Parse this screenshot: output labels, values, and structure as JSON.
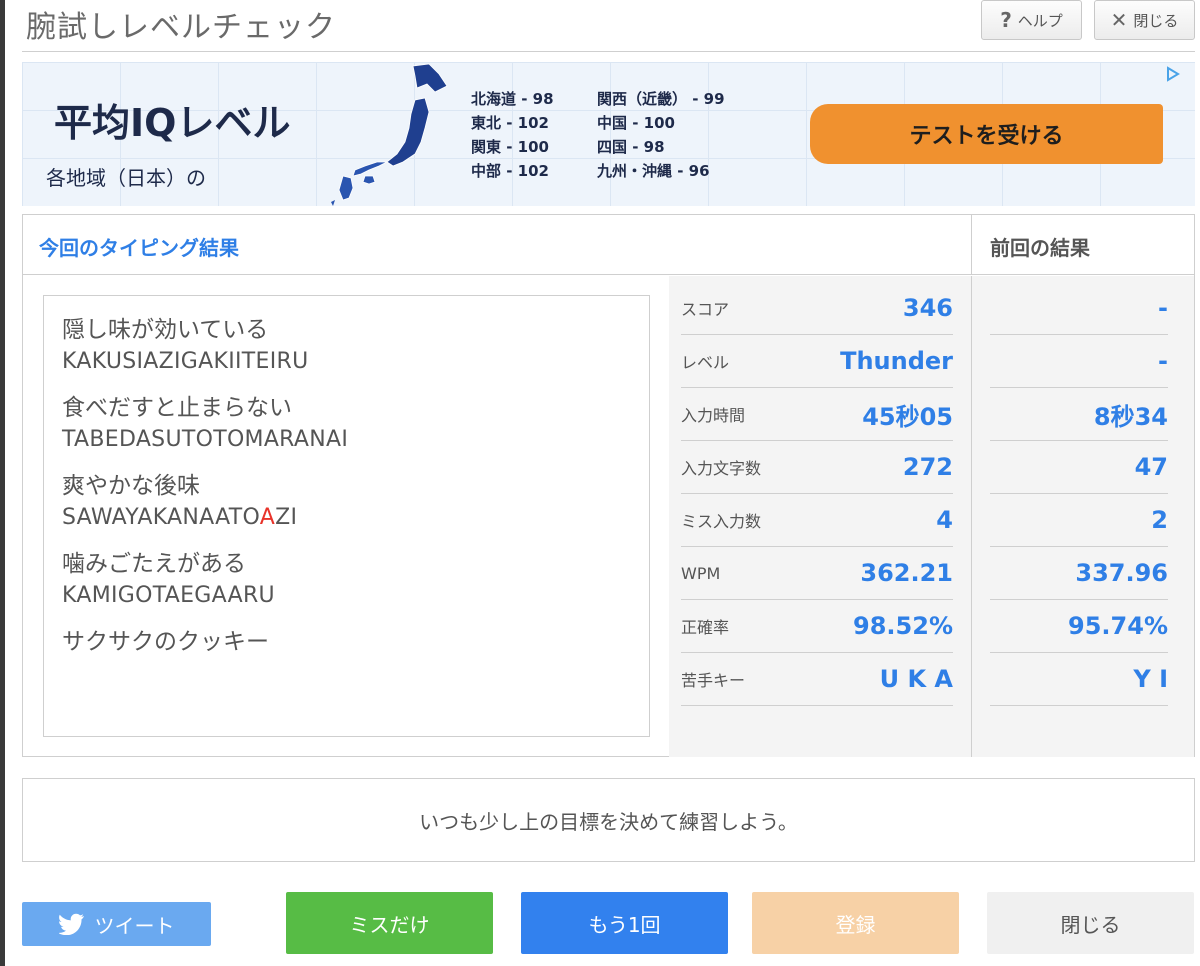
{
  "window": {
    "title": "腕試しレベルチェック",
    "help_label": "ヘルプ",
    "help_icon": "question-icon",
    "close_label": "閉じる",
    "close_icon": "close-icon"
  },
  "ad": {
    "headline": "平均IQレベル",
    "subline": "各地域（日本）の",
    "regions_col1": [
      "北海道 - 98",
      "東北 - 102",
      "関東 - 100",
      "中部 - 102"
    ],
    "regions_col2": [
      "関西（近畿） - 99",
      "中国 - 100",
      "四国 - 98",
      "九州・沖縄 - 96"
    ],
    "cta": "テストを受ける",
    "map_icon": "japan-map-icon",
    "adchoices_icon": "adchoices-icon"
  },
  "results": {
    "current_title": "今回のタイピング結果",
    "previous_title": "前回の結果",
    "phrases": [
      {
        "jp": "隠し味が効いている",
        "romaji_before": "KAKUSIAZIGAKIITEIRU",
        "romaji_miss": "",
        "romaji_after": ""
      },
      {
        "jp": "食べだすと止まらない",
        "romaji_before": "TABEDASUTOTOMARANAI",
        "romaji_miss": "",
        "romaji_after": ""
      },
      {
        "jp": "爽やかな後味",
        "romaji_before": "SAWAYAKANAATO",
        "romaji_miss": "A",
        "romaji_after": "ZI"
      },
      {
        "jp": "噛みごたえがある",
        "romaji_before": "KAMIGOTAEGAARU",
        "romaji_miss": "",
        "romaji_after": ""
      },
      {
        "jp": "サクサクのクッキー",
        "romaji_before": "",
        "romaji_miss": "",
        "romaji_after": ""
      }
    ],
    "stats": [
      {
        "label": "スコア",
        "current": "346",
        "previous": "-"
      },
      {
        "label": "レベル",
        "current": "Thunder",
        "previous": "-"
      },
      {
        "label": "入力時間",
        "current": "45秒05",
        "previous": "8秒34"
      },
      {
        "label": "入力文字数",
        "current": "272",
        "previous": "47"
      },
      {
        "label": "ミス入力数",
        "current": "4",
        "previous": "2"
      },
      {
        "label": "WPM",
        "current": "362.21",
        "previous": "337.96"
      },
      {
        "label": "正確率",
        "current": "98.52%",
        "previous": "95.74%"
      },
      {
        "label": "苦手キー",
        "current": "U K A",
        "previous": "Y I"
      }
    ]
  },
  "message": "いつも少し上の目標を決めて練習しよう。",
  "buttons": {
    "tweet": "ツイート",
    "tweet_icon": "twitter-bird-icon",
    "miss_only": "ミスだけ",
    "again": "もう1回",
    "register": "登録",
    "close": "閉じる"
  },
  "colors": {
    "accent_blue": "#2f7fe6",
    "miss_red": "#e8332a",
    "cta_orange": "#f0912f",
    "green": "#57bc45",
    "register_disabled": "#f7d1a6"
  }
}
